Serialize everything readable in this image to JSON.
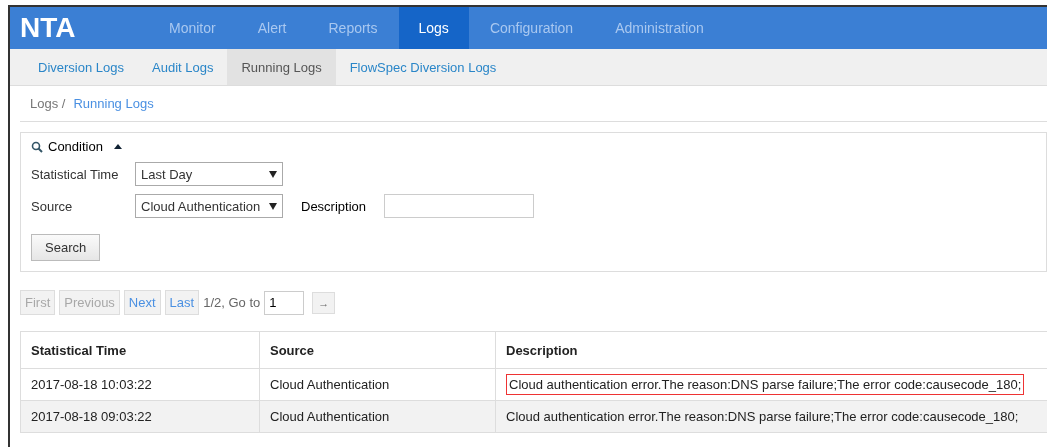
{
  "logo": "NTA",
  "nav": [
    {
      "label": "Monitor",
      "selected": false
    },
    {
      "label": "Alert",
      "selected": false
    },
    {
      "label": "Reports",
      "selected": false
    },
    {
      "label": "Logs",
      "selected": true
    },
    {
      "label": "Configuration",
      "selected": false
    },
    {
      "label": "Administration",
      "selected": false
    }
  ],
  "subnav": [
    {
      "label": "Diversion Logs",
      "selected": false
    },
    {
      "label": "Audit Logs",
      "selected": false
    },
    {
      "label": "Running Logs",
      "selected": true
    },
    {
      "label": "FlowSpec Diversion Logs",
      "selected": false
    }
  ],
  "breadcrumb": [
    "Logs /",
    "Running Logs"
  ],
  "condition": {
    "title": "Condition",
    "expanded": true,
    "time_label": "Statistical Time",
    "time_value": "Last Day",
    "source_label": "Source",
    "source_value": "Cloud Authentication",
    "description_label": "Description",
    "search_button": "Search"
  },
  "pagination": {
    "buttons": [
      {
        "label": "First",
        "disabled": true
      },
      {
        "label": "Previous",
        "disabled": true
      },
      {
        "label": "Next",
        "disabled": false
      },
      {
        "label": "Last",
        "disabled": false
      }
    ],
    "info": "1/2, Go to",
    "page_value": "1",
    "go_button": "→"
  },
  "table": {
    "columns": [
      "Statistical Time",
      "Source",
      "Description"
    ],
    "rows": [
      {
        "cells": [
          "2017-08-18 10:03:22",
          "Cloud Authentication",
          "Cloud authentication error.The reason:DNS parse failure;The error code:causecode_180;"
        ],
        "highlighted": true
      },
      {
        "cells": [
          "2017-08-18 09:03:22",
          "Cloud Authentication",
          "Cloud authentication error.The reason:DNS parse failure;The error code:causecode_180;"
        ],
        "highlighted": false
      }
    ]
  }
}
